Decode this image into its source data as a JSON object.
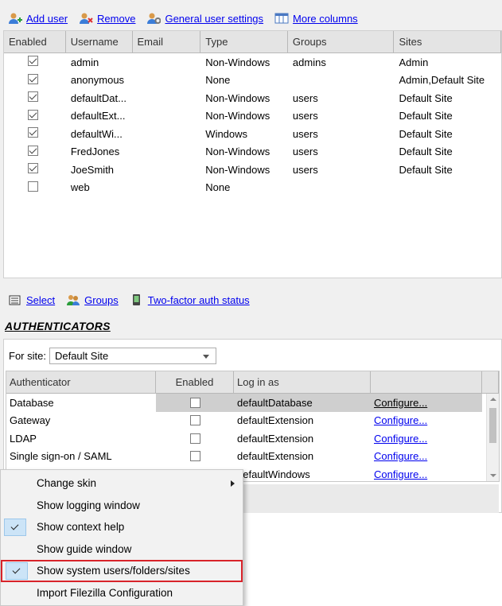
{
  "toolbar": {
    "add_user": "Add user",
    "remove": "Remove",
    "general_settings": "General user settings",
    "more_columns": "More columns"
  },
  "users": {
    "columns": [
      "Enabled",
      "Username",
      "Email",
      "Type",
      "Groups",
      "Sites"
    ],
    "rows": [
      {
        "enabled": true,
        "username": "admin",
        "email": "",
        "type": "Non-Windows",
        "groups": "admins",
        "sites": "Admin"
      },
      {
        "enabled": true,
        "username": "anonymous",
        "email": "",
        "type": "None",
        "groups": "",
        "sites": "Admin,Default Site"
      },
      {
        "enabled": true,
        "username": "defaultDat...",
        "email": "",
        "type": "Non-Windows",
        "groups": "users",
        "sites": "Default Site"
      },
      {
        "enabled": true,
        "username": "defaultExt...",
        "email": "",
        "type": "Non-Windows",
        "groups": "users",
        "sites": "Default Site"
      },
      {
        "enabled": true,
        "username": "defaultWi...",
        "email": "",
        "type": "Windows",
        "groups": "users",
        "sites": "Default Site"
      },
      {
        "enabled": true,
        "username": "FredJones",
        "email": "",
        "type": "Non-Windows",
        "groups": "users",
        "sites": "Default Site"
      },
      {
        "enabled": true,
        "username": "JoeSmith",
        "email": "",
        "type": "Non-Windows",
        "groups": "users",
        "sites": "Default Site"
      },
      {
        "enabled": false,
        "username": "web",
        "email": "",
        "type": "None",
        "groups": "",
        "sites": ""
      }
    ]
  },
  "toolbar2": {
    "select": "Select",
    "groups": "Groups",
    "two_factor": "Two-factor auth status"
  },
  "auth": {
    "title": "AUTHENTICATORS",
    "for_site_label": "For site:",
    "for_site_value": "Default Site",
    "columns": [
      "Authenticator",
      "Enabled",
      "Log in as",
      ""
    ],
    "rows": [
      {
        "name": "Database",
        "enabled": false,
        "login_as": "defaultDatabase",
        "configure": "Configure...",
        "selected": true
      },
      {
        "name": "Gateway",
        "enabled": false,
        "login_as": "defaultExtension",
        "configure": "Configure...",
        "selected": false
      },
      {
        "name": "LDAP",
        "enabled": false,
        "login_as": "defaultExtension",
        "configure": "Configure...",
        "selected": false
      },
      {
        "name": "Single sign-on / SAML",
        "enabled": false,
        "login_as": "defaultExtension",
        "configure": "Configure...",
        "selected": false
      },
      {
        "name": "",
        "enabled": false,
        "login_as": "defaultWindows",
        "configure": "Configure...",
        "selected": false
      }
    ]
  },
  "menu": {
    "items": [
      {
        "label": "Change skin",
        "checked": false,
        "submenu": true
      },
      {
        "label": "Show logging window",
        "checked": false,
        "submenu": false
      },
      {
        "label": "Show context help",
        "checked": true,
        "submenu": false
      },
      {
        "label": "Show guide window",
        "checked": false,
        "submenu": false
      },
      {
        "label": "Show system users/folders/sites",
        "checked": true,
        "submenu": false,
        "highlighted": true
      },
      {
        "label": "Import Filezilla Configuration",
        "checked": false,
        "submenu": false
      }
    ]
  },
  "colors": {
    "link": "#0000ee",
    "highlight_border": "#d8232a",
    "check_bg": "#cce4f7",
    "selected_row": "#cfcfcf"
  }
}
